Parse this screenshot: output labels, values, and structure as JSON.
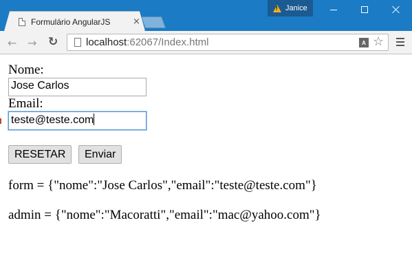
{
  "window": {
    "profile_name": "Janice",
    "tab_title": "Formulário AngularJS",
    "tab_close": "×"
  },
  "toolbar": {
    "url_host": "localhost",
    "url_path": ":62067/Index.html",
    "translate_glyph": "A"
  },
  "form": {
    "nome_label": "Nome:",
    "nome_value": "Jose Carlos",
    "email_label": "Email:",
    "email_value": "teste@teste.com",
    "reset_label": "RESETAR",
    "submit_label": "Enviar"
  },
  "output": {
    "form_line": "form = {\"nome\":\"Jose Carlos\",\"email\":\"teste@teste.com\"}",
    "admin_line": "admin = {\"nome\":\"Macoratti\",\"email\":\"mac@yahoo.com\"}"
  },
  "colors": {
    "titlebar": "#1b7bc4",
    "focus_border": "#5b9bd5",
    "warning": "#f5b21b"
  }
}
